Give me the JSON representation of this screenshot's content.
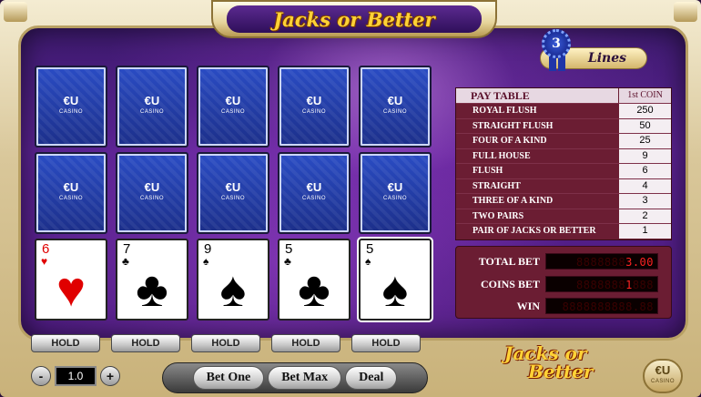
{
  "title": "Jacks or Better",
  "lines": {
    "count": "3",
    "label": "Lines"
  },
  "card_back_logo": {
    "mark": "€U",
    "sub": "CASINO"
  },
  "hand": [
    {
      "rank": "6",
      "suit": "♥",
      "color": "#e00000"
    },
    {
      "rank": "7",
      "suit": "♣",
      "color": "#000000"
    },
    {
      "rank": "9",
      "suit": "♠",
      "color": "#000000"
    },
    {
      "rank": "5",
      "suit": "♣",
      "color": "#000000"
    },
    {
      "rank": "5",
      "suit": "♠",
      "color": "#000000",
      "selected": true
    }
  ],
  "hold_label": "HOLD",
  "paytable": {
    "header": "PAY TABLE",
    "coin_header": "1st COIN",
    "rows": [
      {
        "hand": "ROYAL FLUSH",
        "pays": "250"
      },
      {
        "hand": "STRAIGHT FLUSH",
        "pays": "50"
      },
      {
        "hand": "FOUR OF A KIND",
        "pays": "25"
      },
      {
        "hand": "FULL HOUSE",
        "pays": "9"
      },
      {
        "hand": "FLUSH",
        "pays": "6"
      },
      {
        "hand": "STRAIGHT",
        "pays": "4"
      },
      {
        "hand": "THREE OF A KIND",
        "pays": "3"
      },
      {
        "hand": "TWO PAIRS",
        "pays": "2"
      },
      {
        "hand": "PAIR OF  JACKS OR BETTER",
        "pays": "1"
      }
    ]
  },
  "betinfo": {
    "total_bet_label": "TOTAL BET",
    "total_bet_value": "3.00",
    "coins_bet_label": "COINS BET",
    "coins_bet_value": "1",
    "win_label": "WIN",
    "win_value": ""
  },
  "controls": {
    "minus": "-",
    "plus": "+",
    "coin_value": "1.0",
    "bet_one": "Bet One",
    "bet_max": "Bet Max",
    "deal": "Deal"
  },
  "bottom_logo": {
    "line1": "Jacks or",
    "line2": "Better"
  },
  "eu_badge": {
    "mark": "€U",
    "sub": "CASINO"
  },
  "colors": {
    "felt": "#5a2291",
    "title_gold": "#ffd236",
    "paytable_bg": "#6b1d33",
    "led_on": "#ff2222"
  }
}
